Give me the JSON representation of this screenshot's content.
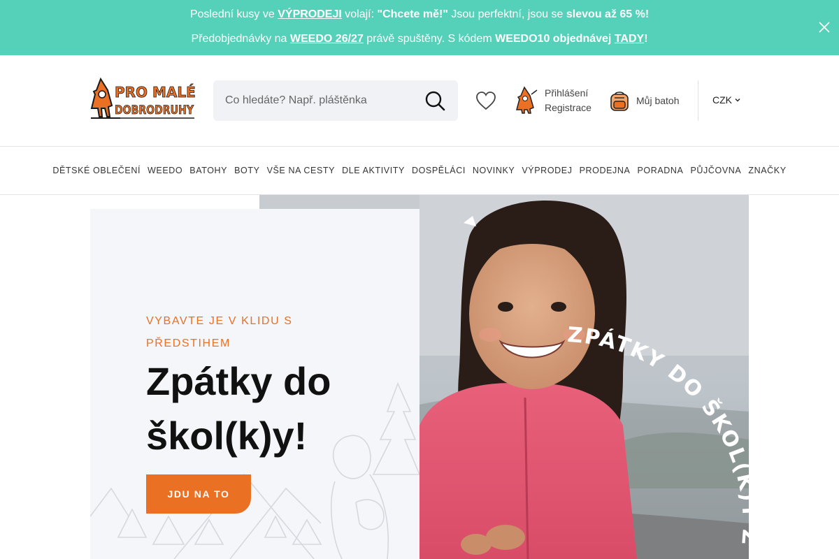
{
  "promo": {
    "line1": {
      "t1": "Poslední kusy ve ",
      "link": "VÝPRODEJI",
      "t2": " volají: ",
      "quote": "\"Chcete mě!\"",
      "t3": " Jsou perfektní, jsou se ",
      "bold": "slevou až 65 %!"
    },
    "line2": {
      "t1": "Předobjednávky na ",
      "link": "WEEDO 26/27",
      "t2": " právě spuštěny. S kódem ",
      "bold": "WEEDO10 objednávej",
      "t3": " ",
      "link2": "TADY",
      "t4": "!"
    },
    "close_icon": "close-icon"
  },
  "header": {
    "logo_line1": "PRO MALÉ",
    "logo_line2": "DOBRODRUHY",
    "search_placeholder": "Co hledáte? Např. pláštěnka",
    "login_label": "Přihlášení",
    "register_label": "Registrace",
    "bag_label": "Můj batoh",
    "currency": "CZK"
  },
  "nav": {
    "items": [
      "DĚTSKÉ OBLEČENÍ",
      "WEEDO",
      "BATOHY",
      "BOTY",
      "VŠE NA CESTY",
      "DLE AKTIVITY",
      "DOSPĚLÁCI",
      "NOVINKY",
      "VÝPRODEJ",
      "PRODEJNA",
      "PORADNA",
      "PŮJČOVNA",
      "ZNAČKY"
    ]
  },
  "hero": {
    "kicker": "VYBAVTE JE V KLIDU S PŘEDSTIHEM",
    "title": "Zpátky do škol(k)y!",
    "cta": "JDU NA TO",
    "photo_text": "ZPÁTKY DO ŠKOL(K)Y ZPÁTKY"
  },
  "colors": {
    "promo_bg": "#55d0b9",
    "accent": "#ea7024",
    "panel_bg": "#f5f6f9"
  }
}
